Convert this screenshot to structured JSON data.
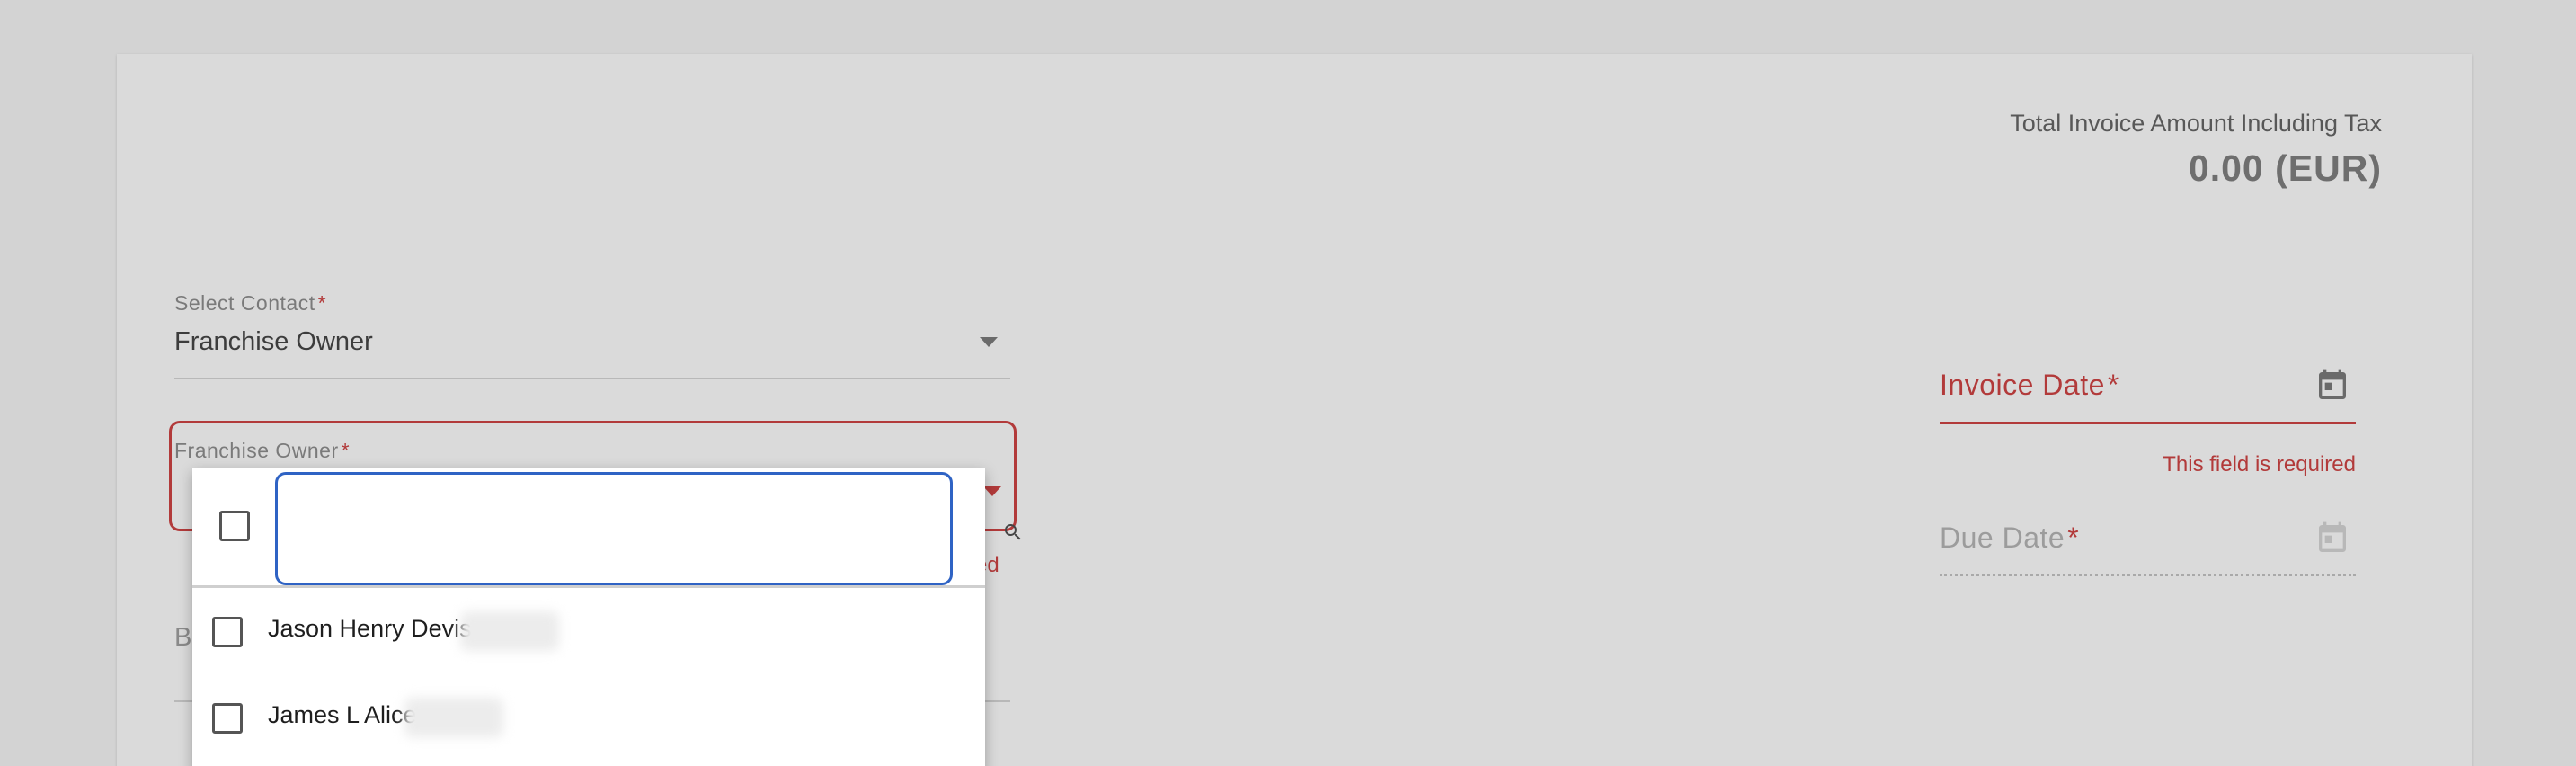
{
  "total": {
    "label": "Total Invoice Amount Including Tax",
    "value": "0.00 (EUR)"
  },
  "contact_select": {
    "label": "Select Contact",
    "required_mark": "*",
    "value": "Franchise Owner"
  },
  "franchise_owner": {
    "label": "Franchise Owner",
    "required_mark": "*",
    "error_fragment": "ed"
  },
  "hidden_field": {
    "label_fragment": "B"
  },
  "dropdown": {
    "search_value": "",
    "options": [
      {
        "label": "Jason Henry Devis",
        "checked": false
      },
      {
        "label": "James L Alice",
        "checked": false
      }
    ]
  },
  "invoice_date": {
    "label": "Invoice Date",
    "required_mark": "*",
    "error": "This field is required"
  },
  "due_date": {
    "label": "Due Date",
    "required_mark": "*"
  },
  "colors": {
    "error": "#b23a3a",
    "focus": "#2f63c4",
    "background": "#d3d3d3"
  }
}
